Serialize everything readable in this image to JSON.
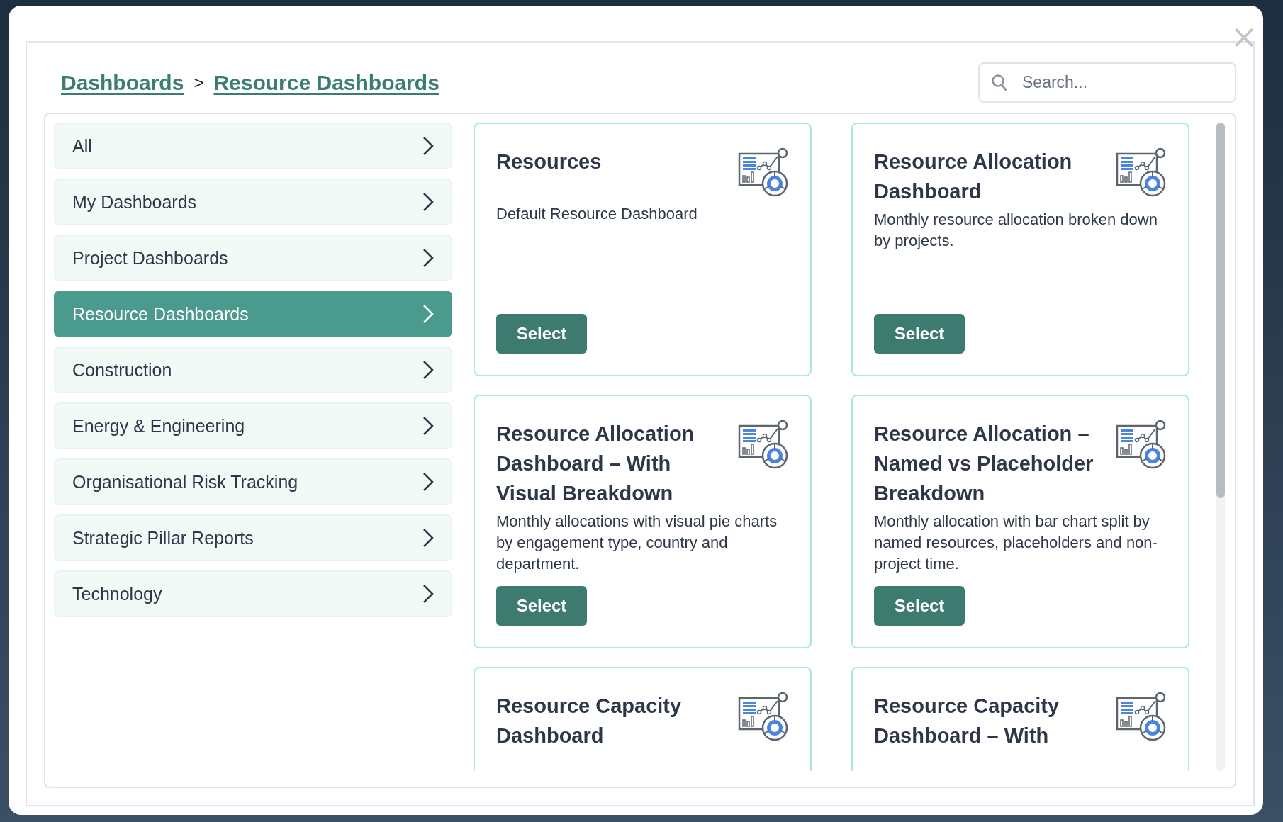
{
  "breadcrumb": [
    {
      "label": "Dashboards"
    },
    {
      "label": "Resource Dashboards"
    }
  ],
  "breadcrumb_separator": ">",
  "search": {
    "placeholder": "Search..."
  },
  "categories": [
    {
      "label": "All",
      "selected": false
    },
    {
      "label": "My Dashboards",
      "selected": false
    },
    {
      "label": "Project Dashboards",
      "selected": false
    },
    {
      "label": "Resource Dashboards",
      "selected": true
    },
    {
      "label": "Construction",
      "selected": false
    },
    {
      "label": "Energy & Engineering",
      "selected": false
    },
    {
      "label": "Organisational Risk Tracking",
      "selected": false
    },
    {
      "label": "Strategic Pillar Reports",
      "selected": false
    },
    {
      "label": "Technology",
      "selected": false
    }
  ],
  "dashboards": [
    {
      "title": "Resources",
      "description": "Default Resource Dashboard",
      "button": "Select"
    },
    {
      "title": "Resource Allocation Dashboard",
      "description": "Monthly resource allocation broken down by projects.",
      "button": "Select"
    },
    {
      "title": "Resource Allocation Dashboard – With Visual Breakdown",
      "description": "Monthly allocations with visual pie charts by engagement type, country and department.",
      "button": "Select"
    },
    {
      "title": "Resource Allocation – Named vs Placeholder Breakdown",
      "description": "Monthly allocation with bar chart split by named resources, placeholders and non-project time.",
      "button": "Select"
    },
    {
      "title": "Resource Capacity Dashboard"
    },
    {
      "title": "Resource Capacity Dashboard – With"
    }
  ]
}
